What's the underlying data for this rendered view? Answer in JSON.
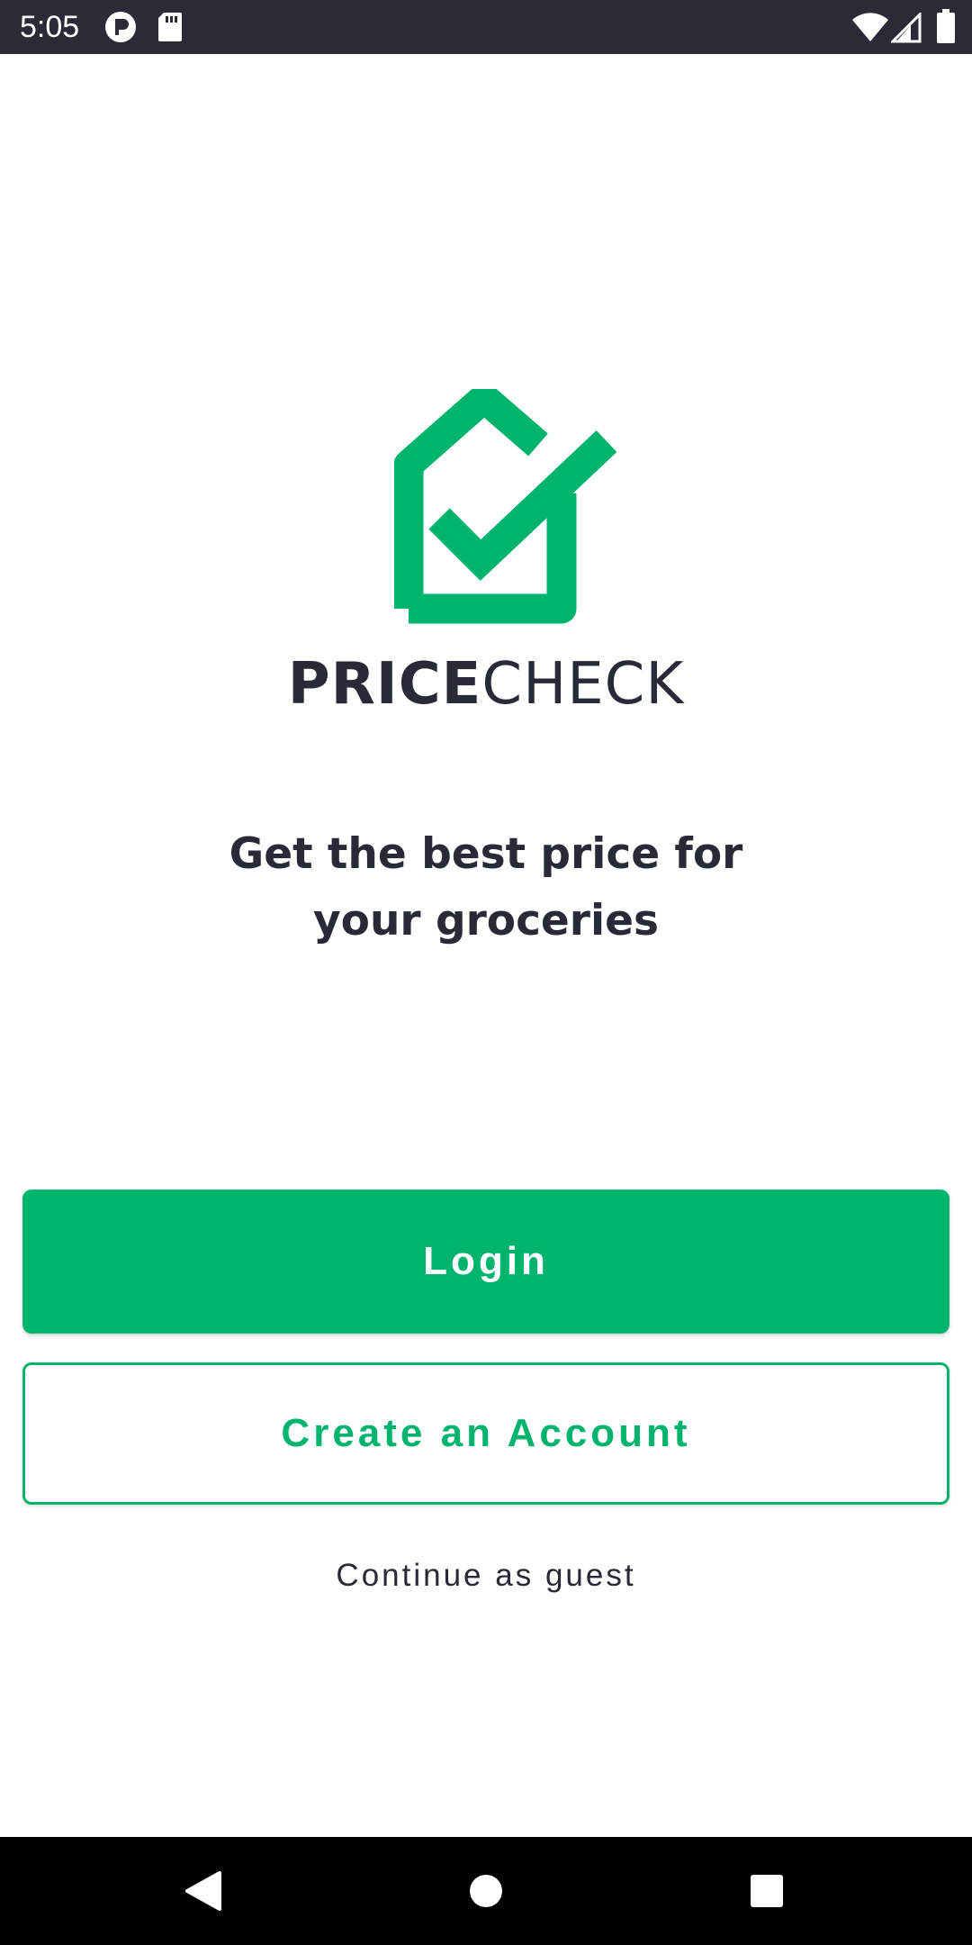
{
  "status_bar": {
    "time": "5:05",
    "left_icons": [
      "app-notification-icon",
      "sd-card-icon"
    ],
    "right_icons": [
      "wifi-icon",
      "cell-signal-icon",
      "battery-icon"
    ]
  },
  "brand": {
    "logo_icon": "price-tag-check-icon",
    "name_bold": "PRICE",
    "name_light": "CHECK",
    "accent_color": "#00b46e",
    "text_color": "#282a38"
  },
  "tagline": {
    "line1": "Get the best price for",
    "line2": "your groceries"
  },
  "actions": {
    "login_label": "Login",
    "create_account_label": "Create an Account",
    "guest_label": "Continue as guest"
  },
  "nav_bar": {
    "icons": [
      "back-icon",
      "home-icon",
      "recents-icon"
    ]
  }
}
